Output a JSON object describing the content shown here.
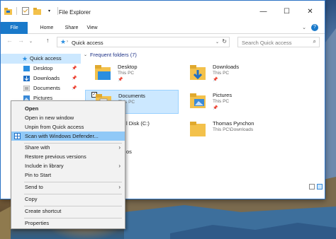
{
  "window": {
    "title": "File Explorer"
  },
  "ribbon": {
    "tabs": [
      "File",
      "Home",
      "Share",
      "View"
    ],
    "help": "?"
  },
  "address": {
    "path": "Quick access",
    "search_placeholder": "Search Quick access"
  },
  "nav": {
    "quick_access": "Quick access",
    "items": [
      "Desktop",
      "Downloads",
      "Documents",
      "Pictures"
    ]
  },
  "content": {
    "group_header": "Frequent folders (7)",
    "tiles": [
      {
        "name": "Desktop",
        "sub": "This PC"
      },
      {
        "name": "Downloads",
        "sub": "This PC"
      },
      {
        "name": "Documents",
        "sub": "This PC"
      },
      {
        "name": "Pictures",
        "sub": "This PC"
      },
      {
        "name": "l Disk (C:)",
        "sub": ""
      },
      {
        "name": "Thomas Pynchon",
        "sub": "This PC\\Downloads"
      },
      {
        "name": "os",
        "sub": ""
      }
    ]
  },
  "context_menu": {
    "items": [
      "Open",
      "Open in new window",
      "Unpin from Quick access",
      "Scan with Windows Defender...",
      "Share with",
      "Restore previous versions",
      "Include in library",
      "Pin to Start",
      "Send to",
      "Copy",
      "Create shortcut",
      "Properties"
    ]
  },
  "colors": {
    "accent": "#1979ca",
    "selection": "#cce8ff",
    "menu_highlight": "#91c9f7",
    "folder": "#f3c14b"
  }
}
